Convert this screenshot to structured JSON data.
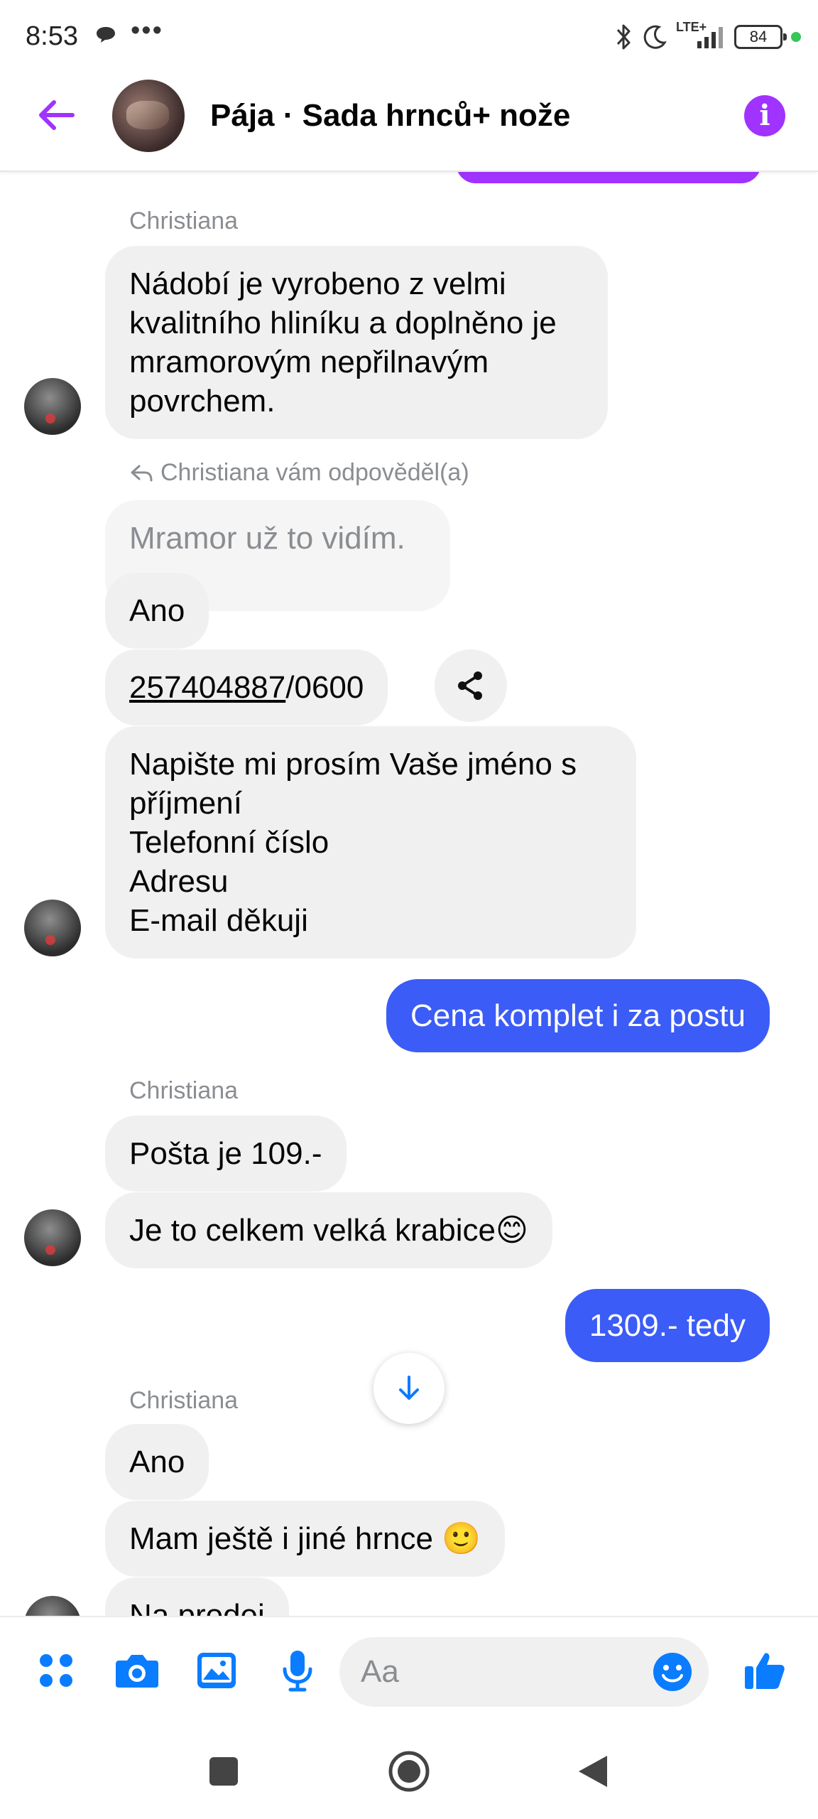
{
  "status": {
    "time": "8:53",
    "dots": "•••",
    "network": "LTE+",
    "battery": "84"
  },
  "header": {
    "title": "Pája · Sada hrnců+ nože",
    "info_glyph": "i"
  },
  "messages": {
    "g1_sender": "Christiana",
    "g1_m1": "Nádobí je vyrobeno z velmi kvalitního hliníku a doplněno je mramorovým nepřilnavým povrchem.",
    "reply_note": "Christiana vám odpověděl(a)",
    "quoted": "Mramor už to vidím.",
    "g2_m1": "Ano",
    "acct_number": "257404887",
    "acct_suffix": "/0600",
    "g2_m3_l1": "Napište mi prosím Vaše jméno s",
    "g2_m3_l2": "příjmení",
    "g2_m3_l3": "Telefonní číslo",
    "g2_m3_l4": "Adresu",
    "g2_m3_l5": "E-mail děkuji",
    "sent1": "Cena komplet  i za postu",
    "g3_sender": "Christiana",
    "g3_m1": "Pošta je 109.-",
    "g3_m2": "Je to celkem velká krabice😊",
    "sent2": "1309.- tedy",
    "g4_sender": "Christiana",
    "g4_m1": "Ano",
    "g4_m2": "Mam ještě i jiné hrnce 🙂",
    "g4_m3": "Na prodej"
  },
  "composer": {
    "placeholder": "Aa"
  },
  "colors": {
    "accent_purple": "#a033ff",
    "sent_blue": "#3b5cf6",
    "icon_blue": "#0a7cff"
  }
}
